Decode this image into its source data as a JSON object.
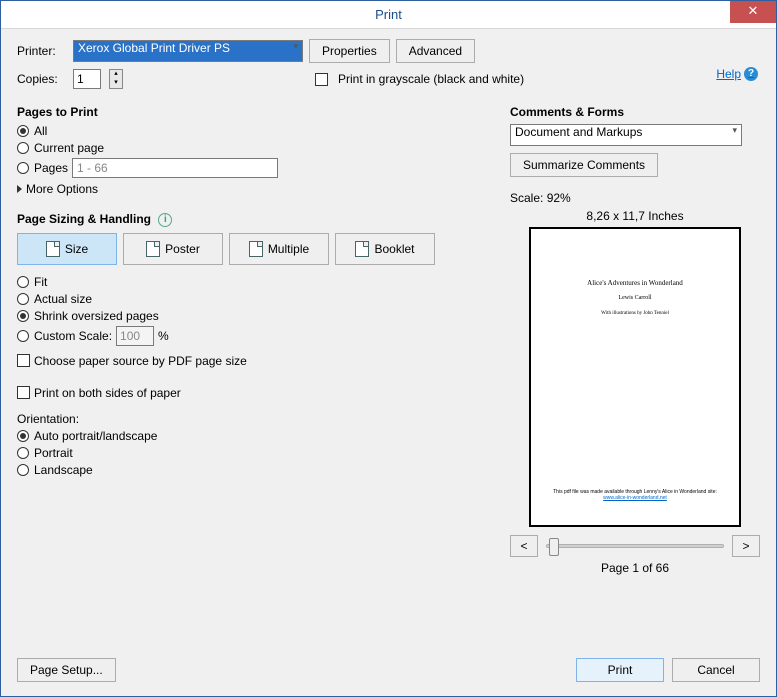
{
  "title": "Print",
  "help_label": "Help",
  "printer": {
    "label": "Printer:",
    "selected": "Xerox Global Print Driver PS",
    "properties_btn": "Properties",
    "advanced_btn": "Advanced"
  },
  "copies": {
    "label": "Copies:",
    "value": "1"
  },
  "grayscale": {
    "label": "Print in grayscale (black and white)",
    "checked": false
  },
  "pages_to_print": {
    "heading": "Pages to Print",
    "options": {
      "all": "All",
      "current": "Current page",
      "pages": "Pages"
    },
    "range_placeholder": "1 - 66",
    "selected": "all",
    "more_options": "More Options"
  },
  "sizing": {
    "heading": "Page Sizing & Handling",
    "tabs": {
      "size": "Size",
      "poster": "Poster",
      "multiple": "Multiple",
      "booklet": "Booklet"
    },
    "active_tab": "size",
    "fit": "Fit",
    "actual": "Actual size",
    "shrink": "Shrink oversized pages",
    "custom": "Custom Scale:",
    "custom_value": "100",
    "custom_unit": "%",
    "selected": "shrink",
    "choose_paper": "Choose paper source by PDF page size",
    "both_sides": "Print on both sides of paper"
  },
  "orientation": {
    "heading": "Orientation:",
    "auto": "Auto portrait/landscape",
    "portrait": "Portrait",
    "landscape": "Landscape",
    "selected": "auto"
  },
  "comments_forms": {
    "heading": "Comments & Forms",
    "selected": "Document and Markups",
    "summarize_btn": "Summarize Comments"
  },
  "preview": {
    "scale_label": "Scale:",
    "scale_value": "92%",
    "dimensions": "8,26 x 11,7 Inches",
    "doc_title": "Alice's Adventures in Wonderland",
    "doc_author": "Lewis Carroll",
    "doc_ill": "With illustrations by John Tenniel",
    "doc_note": "This pdf file was made available through Lenny's Alice in Wonderland site:",
    "doc_link": "www.alice-in-wonderland.net",
    "page_of": "Page 1 of 66"
  },
  "footer": {
    "page_setup": "Page Setup...",
    "print": "Print",
    "cancel": "Cancel"
  }
}
